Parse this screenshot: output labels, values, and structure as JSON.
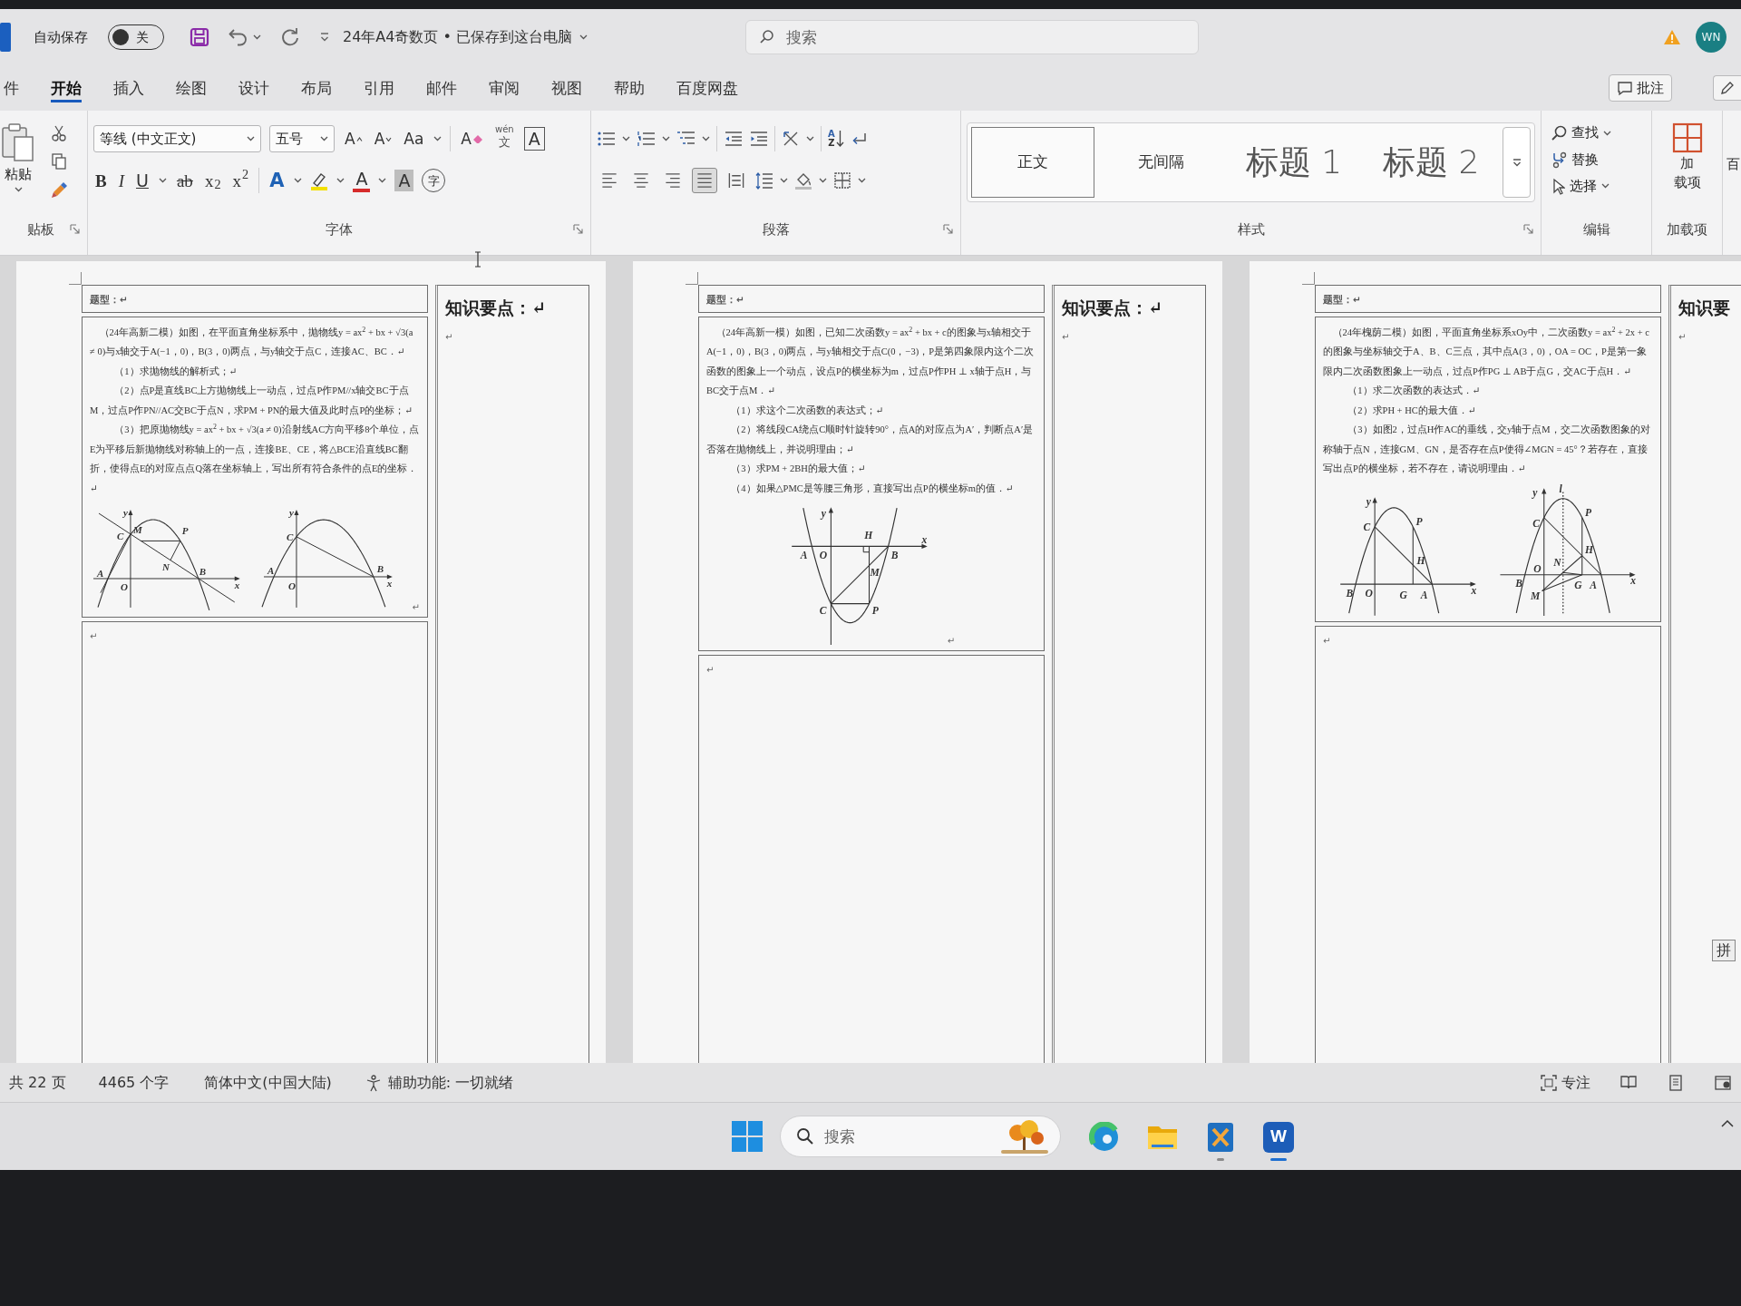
{
  "title_bar": {
    "autosave_label": "自动保存",
    "autosave_toggle": {
      "on": false,
      "label": "关"
    },
    "document_title": "24年A4奇数页 • 已保存到这台电脑",
    "search": {
      "placeholder": "搜索"
    },
    "avatar": "WN"
  },
  "tabs": [
    {
      "label": "件",
      "selected": false
    },
    {
      "label": "开始",
      "selected": true
    },
    {
      "label": "插入",
      "selected": false
    },
    {
      "label": "绘图",
      "selected": false
    },
    {
      "label": "设计",
      "selected": false
    },
    {
      "label": "布局",
      "selected": false
    },
    {
      "label": "引用",
      "selected": false
    },
    {
      "label": "邮件",
      "selected": false
    },
    {
      "label": "审阅",
      "selected": false
    },
    {
      "label": "视图",
      "selected": false
    },
    {
      "label": "帮助",
      "selected": false
    },
    {
      "label": "百度网盘",
      "selected": false
    }
  ],
  "comment_button": "批注",
  "ribbon": {
    "clipboard": {
      "paste": "粘贴",
      "label": "贴板"
    },
    "font": {
      "font_name": "等线 (中文正文)",
      "font_size": "五号",
      "row_1": [
        {
          "kind": "grow",
          "label": "A"
        },
        {
          "kind": "shrink",
          "label": "A"
        },
        {
          "kind": "case",
          "label": "Aa"
        },
        {
          "kind": "clear",
          "label": "A"
        },
        {
          "kind": "phonetic",
          "label": "wén",
          "sub": "文"
        },
        {
          "kind": "border",
          "label": "A"
        }
      ],
      "row_2": [
        {
          "kind": "bold",
          "label": "B"
        },
        {
          "kind": "italic",
          "label": "I"
        },
        {
          "kind": "underline",
          "label": "U"
        },
        {
          "kind": "strike",
          "label": "ab"
        },
        {
          "kind": "subscript",
          "label": "x$_{2}$"
        },
        {
          "kind": "superscript",
          "label": "x$^{2}$"
        },
        {
          "kind": "effect",
          "label": "A"
        },
        {
          "kind": "highlight"
        },
        {
          "kind": "color",
          "label": "A"
        },
        {
          "kind": "shading",
          "label": "A"
        },
        {
          "kind": "enclose",
          "label": "字"
        }
      ],
      "label": "字体"
    },
    "paragraph": {
      "sort": {
        "top": "A",
        "bottom": "Z"
      },
      "alignment": [
        {
          "selected": false
        },
        {
          "selected": false
        },
        {
          "selected": false
        },
        {
          "selected": true
        },
        {
          "selected": false
        }
      ],
      "label": "段落"
    },
    "styles": {
      "items": [
        {
          "label": "正文",
          "kind": "body",
          "selected": true
        },
        {
          "label": "无间隔",
          "kind": "body",
          "selected": false
        },
        {
          "label": "标题 1",
          "kind": "heading",
          "selected": false
        },
        {
          "label": "标题 2",
          "kind": "heading",
          "selected": false
        }
      ],
      "label": "样式"
    },
    "editing": {
      "find": "查找",
      "replace": "替换",
      "select": "选择",
      "label": "编辑"
    },
    "add_ins": {
      "button_lines": [
        "加",
        "载项"
      ],
      "label": "加载项"
    },
    "next_group": {
      "label": "百"
    }
  },
  "document": {
    "pages": [
      {
        "heading": "题型：↵",
        "problem": [
          {
            "kind": "stem",
            "text": "（24年高新二模）如图，在平面直角坐标系中，抛物线y = ax$^{2}$ + bx + √3(a ≠ 0)与x轴交于A(−1，0)，B(3，0)两点，与y轴交于点C，连接AC、BC．↵"
          },
          {
            "kind": "question",
            "text": "（1）求抛物线的解析式；↵"
          },
          {
            "kind": "question",
            "text": "（2）点P是直线BC上方抛物线上一动点，过点P作PM//x轴交BC于点M，过点P作PN//AC交BC于点N，求PM + PN的最大值及此时点P的坐标；↵"
          },
          {
            "kind": "question",
            "text": "（3）把原抛物线y = ax$^{2}$ + bx + √3(a ≠ 0)沿射线AC方向平移8个单位，点E为平移后新抛物线对称轴上的一点，连接BE、CE，将△BCE沿直线BC翻折，使得点E的对应点点Q落在坐标轴上，写出所有符合条件的点E的坐标．↵"
          }
        ],
        "figures": [
          {
            "kind": "pm-pn",
            "labels": [
              "y",
              "C",
              "M",
              "P",
              "N",
              "A",
              "B",
              "O",
              "x"
            ]
          },
          {
            "kind": "cb",
            "labels": [
              "y",
              "C",
              "A",
              "B",
              "O",
              "x"
            ]
          }
        ],
        "end_mark": "↵",
        "answer": "↵",
        "notes": {
          "heading": "知识要点：↵",
          "body": "↵"
        }
      },
      {
        "heading": "题型：↵",
        "problem": [
          {
            "kind": "stem",
            "text": "（24年高新一模）如图，已知二次函数y = ax$^{2}$ + bx + c的图象与x轴相交于A(−1，0)，B(3，0)两点，与y轴相交于点C(0，−3)，P是第四象限内这个二次函数的图象上一个动点，设点P的横坐标为m，过点P作PH ⊥ x轴于点H，与BC交于点M．↵"
          },
          {
            "kind": "question",
            "text": "（1）求这个二次函数的表达式；↵"
          },
          {
            "kind": "question",
            "text": "（2）将线段CA绕点C顺时针旋转90°，点A的对应点为A′，判断点A′是否落在抛物线上，并说明理由；↵"
          },
          {
            "kind": "question",
            "text": "（3）求PM + 2BH的最大值；↵"
          },
          {
            "kind": "question",
            "text": "（4）如果△PMC是等腰三角形，直接写出点P的横坐标m的值．↵"
          }
        ],
        "figures": [
          {
            "kind": "ph-pm",
            "labels": [
              "y",
              "H",
              "A",
              "O",
              "B",
              "x",
              "M",
              "C",
              "P"
            ]
          }
        ],
        "end_mark": "↵",
        "answer": "↵",
        "notes": {
          "heading": "知识要点：↵",
          "body": "↵"
        }
      },
      {
        "heading": "题型：↵",
        "problem": [
          {
            "kind": "stem",
            "text": "（24年槐荫二模）如图，平面直角坐标系xOy中，二次函数y = ax$^{2}$ + 2x + c的图象与坐标轴交于A、B、C三点，其中点A(3，0)，OA = OC，P是第一象限内二次函数图象上一动点，过点P作PG ⊥ AB于点G，交AC于点H．↵"
          },
          {
            "kind": "question",
            "text": "（1）求二次函数的表达式．↵"
          },
          {
            "kind": "question",
            "text": "（2）求PH + HC的最大值．↵"
          },
          {
            "kind": "question",
            "text": "（3）如图2，过点H作AC的垂线，交y轴于点M，交二次函数图象的对称轴于点N，连接GM、GN，是否存在点P使得∠MGN = 45°？若存在，直接写出点P的横坐标，若不存在，请说明理由．↵"
          }
        ],
        "figures": [
          {
            "kind": "pg-ph",
            "labels": [
              "y",
              "C",
              "P",
              "H",
              "B",
              "O",
              "G",
              "A",
              "x"
            ]
          },
          {
            "kind": "mgn",
            "labels": [
              "y",
              "l",
              "P",
              "C",
              "H",
              "N",
              "O",
              "B",
              "M",
              "G",
              "A",
              "x"
            ]
          }
        ],
        "answer": "↵",
        "notes": {
          "heading": "知识要",
          "body": "↵"
        }
      }
    ]
  },
  "ime_indicator": "拼",
  "status_bar": {
    "page_count": "共 22 页",
    "word_count": "4465 个字",
    "language": "简体中文(中国大陆)",
    "accessibility": "辅助功能: 一切就绪",
    "focus": "专注"
  },
  "taskbar": {
    "search": {
      "placeholder": "搜索"
    },
    "apps": [
      {
        "kind": "edge",
        "open": false,
        "active": false
      },
      {
        "kind": "explorer",
        "open": false,
        "active": false
      },
      {
        "kind": "tool",
        "open": true,
        "active": false
      },
      {
        "kind": "word",
        "label": "W",
        "open": true,
        "active": true
      }
    ]
  }
}
